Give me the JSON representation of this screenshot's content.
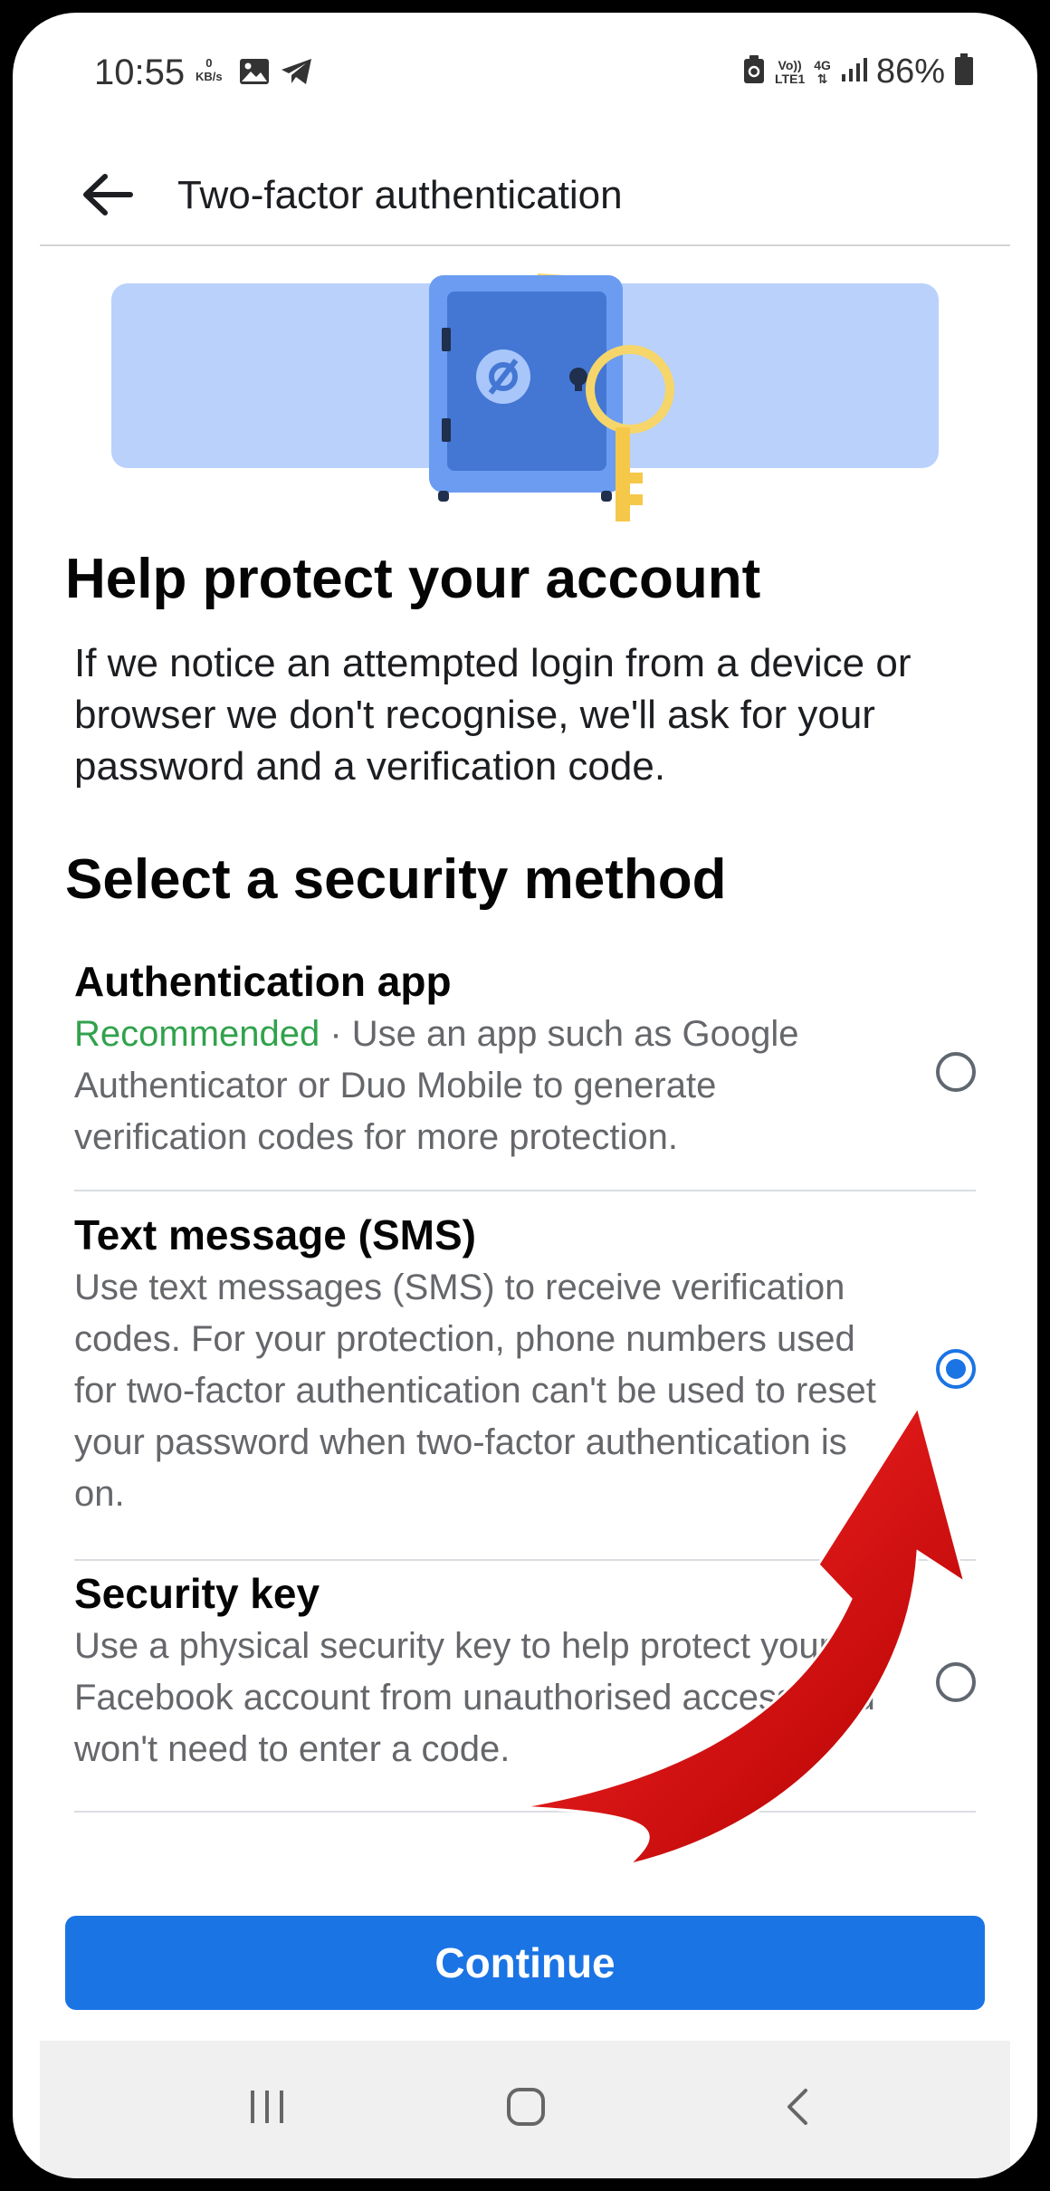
{
  "status_bar": {
    "time": "10:55",
    "speed_value": "0",
    "speed_unit": "KB/s",
    "volte_top": "Vo))",
    "volte_bottom": "LTE1",
    "network": "4G",
    "battery": "86%"
  },
  "header": {
    "title": "Two-factor authentication"
  },
  "main": {
    "title": "Help protect your account",
    "intro": "If we notice an attempted login from a device or browser we don't recognise, we'll ask for your password and a verification code.",
    "section_title": "Select a security method",
    "options": [
      {
        "title": "Authentication app",
        "recommended": "Recommended",
        "description": " · Use an app such as Google Authenticator or Duo Mobile to generate verification codes for more protection.",
        "selected": false
      },
      {
        "title": "Text message (SMS)",
        "description": "Use text messages (SMS) to receive verification codes. For your protection, phone numbers used for two-factor authentication can't be used to reset your password when two-factor authentication is on.",
        "selected": true
      },
      {
        "title": "Security key",
        "description": "Use a physical security key to help protect your Facebook account from unauthorised access. You won't need to enter a code.",
        "selected": false
      }
    ],
    "continue_label": "Continue"
  },
  "colors": {
    "accent": "#1b74e4",
    "recommended": "#31a24c",
    "annotation_arrow": "#e00000"
  },
  "icons": {
    "back": "arrow-left-icon",
    "hero": "safe-with-key-illustration",
    "nav_recents": "recents-icon",
    "nav_home": "home-icon",
    "nav_back": "back-chevron-icon"
  }
}
